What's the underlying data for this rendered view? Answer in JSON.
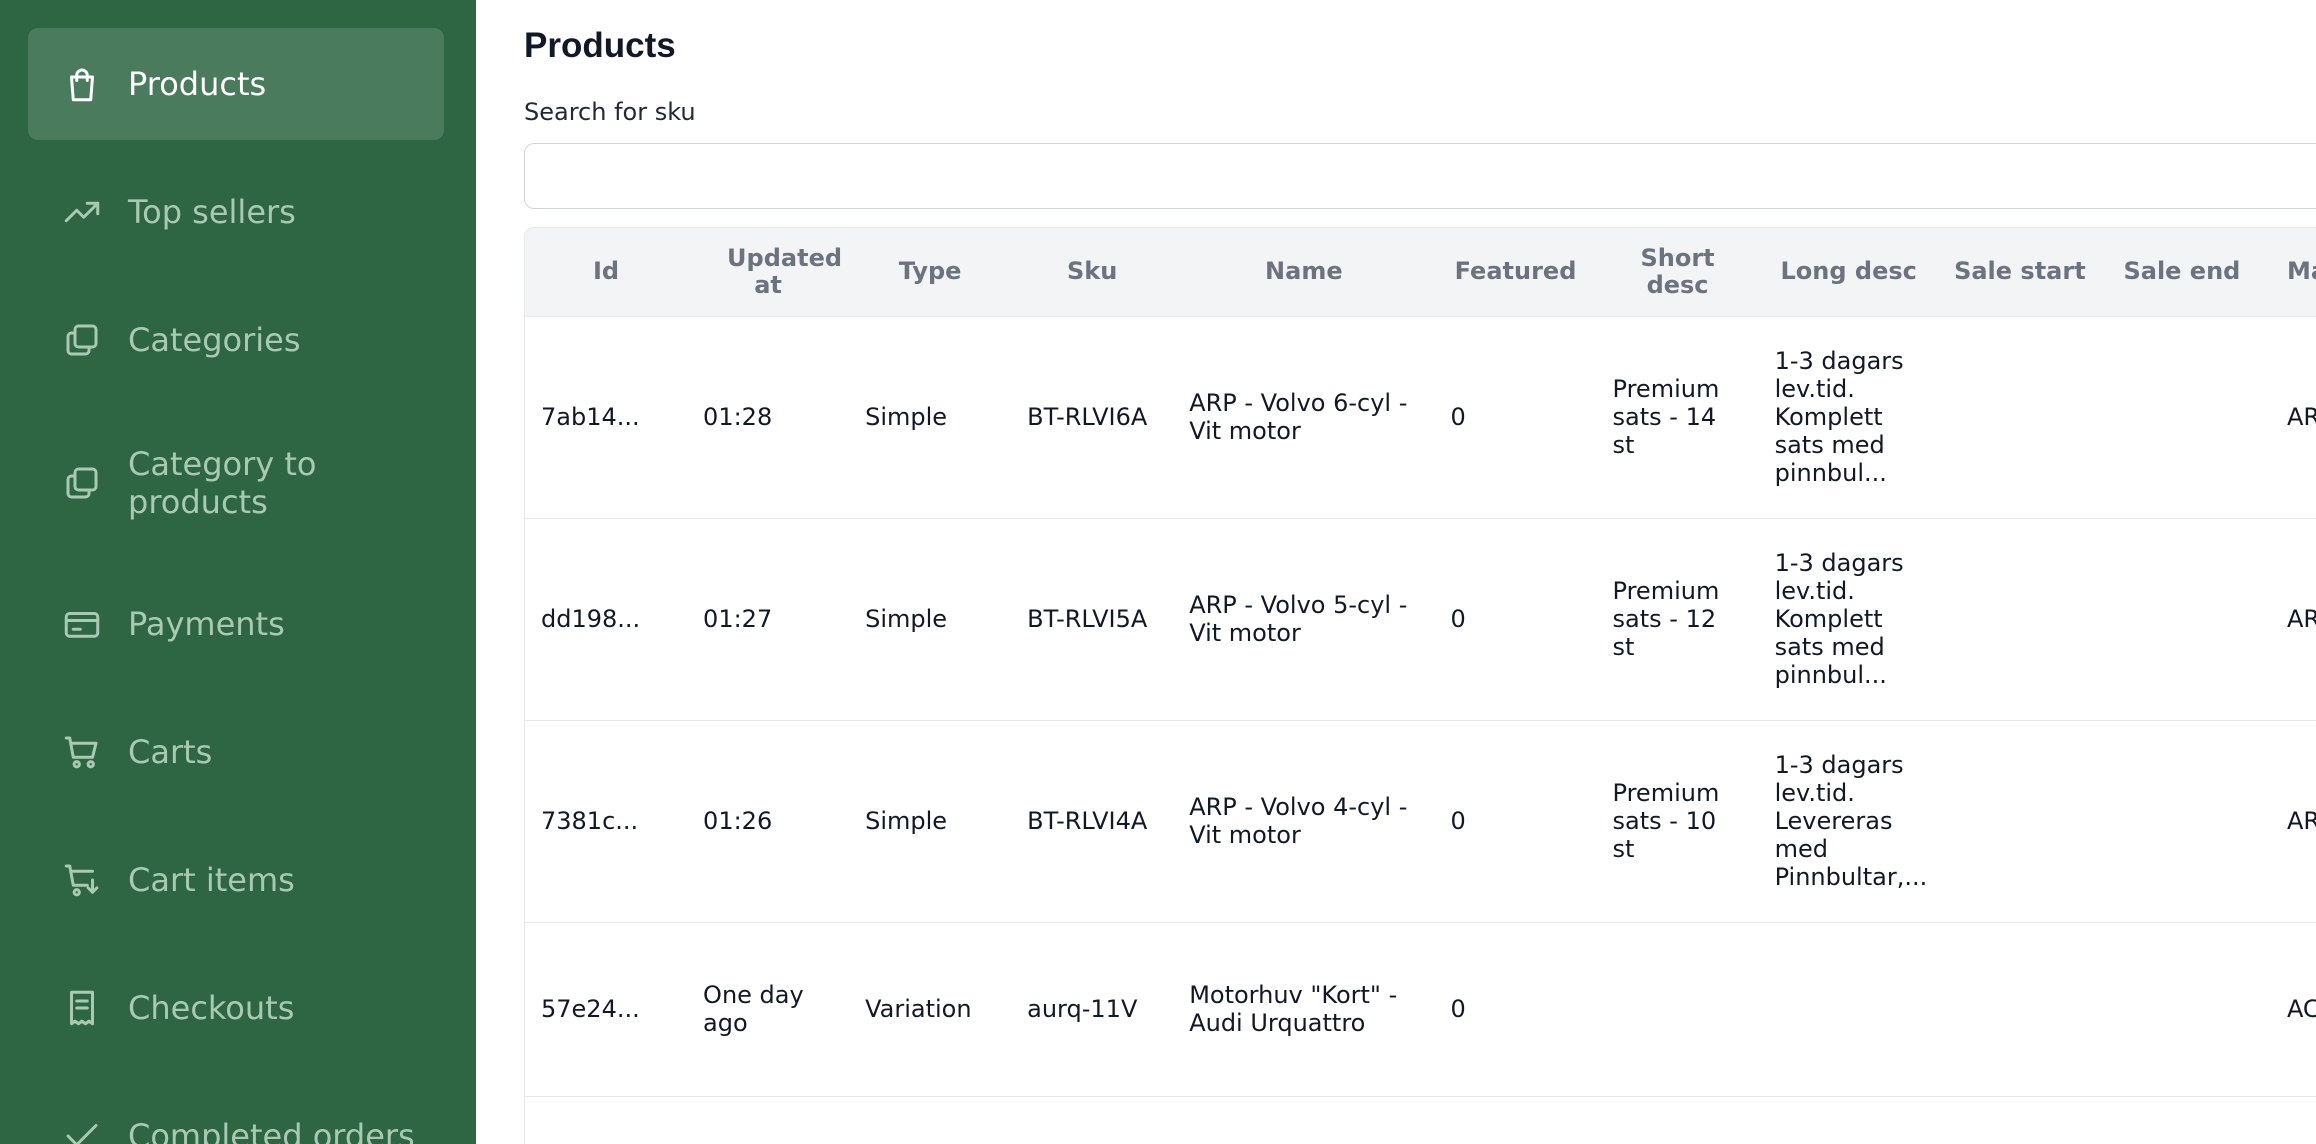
{
  "sidebar": {
    "items": [
      {
        "label": "Products",
        "icon": "shopping-bag-icon"
      },
      {
        "label": "Top sellers",
        "icon": "trending-up-icon"
      },
      {
        "label": "Categories",
        "icon": "copy-icon"
      },
      {
        "label": "Category to products",
        "icon": "copy-icon"
      },
      {
        "label": "Payments",
        "icon": "credit-card-icon"
      },
      {
        "label": "Carts",
        "icon": "cart-icon"
      },
      {
        "label": "Cart items",
        "icon": "cart-download-icon"
      },
      {
        "label": "Checkouts",
        "icon": "receipt-icon"
      },
      {
        "label": "Completed orders",
        "icon": "check-icon"
      }
    ],
    "active": "Products"
  },
  "main": {
    "title": "Products",
    "search": {
      "label": "Search for sku",
      "value": "",
      "placeholder": ""
    }
  },
  "table": {
    "columns": [
      "Id",
      "Updated at",
      "Type",
      "Sku",
      "Name",
      "Featured",
      "Short desc",
      "Long desc",
      "Sale start",
      "Sale end",
      "Manu"
    ],
    "rows": [
      {
        "id": "7ab14...",
        "updated": "01:28",
        "type": "Simple",
        "sku": "BT-RLVI6A",
        "name": "ARP - Volvo 6-cyl - Vit motor",
        "featured": "0",
        "short": "Premium sats - 14 st",
        "long": "1-3 dagars lev.tid. Komplett sats med pinnbul...",
        "sale_start": "",
        "sale_end": "",
        "manu": "ARP"
      },
      {
        "id": "dd198...",
        "updated": "01:27",
        "type": "Simple",
        "sku": "BT-RLVI5A",
        "name": "ARP - Volvo 5-cyl - Vit motor",
        "featured": "0",
        "short": "Premium sats - 12 st",
        "long": "1-3 dagars lev.tid. Komplett sats med pinnbul...",
        "sale_start": "",
        "sale_end": "",
        "manu": "ARP"
      },
      {
        "id": "7381c...",
        "updated": "01:26",
        "type": "Simple",
        "sku": "BT-RLVI4A",
        "name": "ARP - Volvo 4-cyl - Vit motor",
        "featured": "0",
        "short": "Premium sats - 10 st",
        "long": "1-3 dagars lev.tid. Levereras med Pinnbultar,...",
        "sale_start": "",
        "sale_end": "",
        "manu": "ARP"
      },
      {
        "id": "57e24...",
        "updated": "One day ago",
        "type": "Variation",
        "sku": "aurq-11V",
        "name": "Motorhuv \"Kort\" - Audi Urquattro",
        "featured": "0",
        "short": "",
        "long": "",
        "sale_start": "",
        "sale_end": "",
        "manu": "ACM"
      },
      {
        "id": "",
        "updated": "",
        "type": "",
        "sku": "",
        "name": "",
        "featured": "",
        "short": "",
        "long": "",
        "sale_start": "",
        "sale_end": "",
        "manu": ""
      }
    ]
  }
}
